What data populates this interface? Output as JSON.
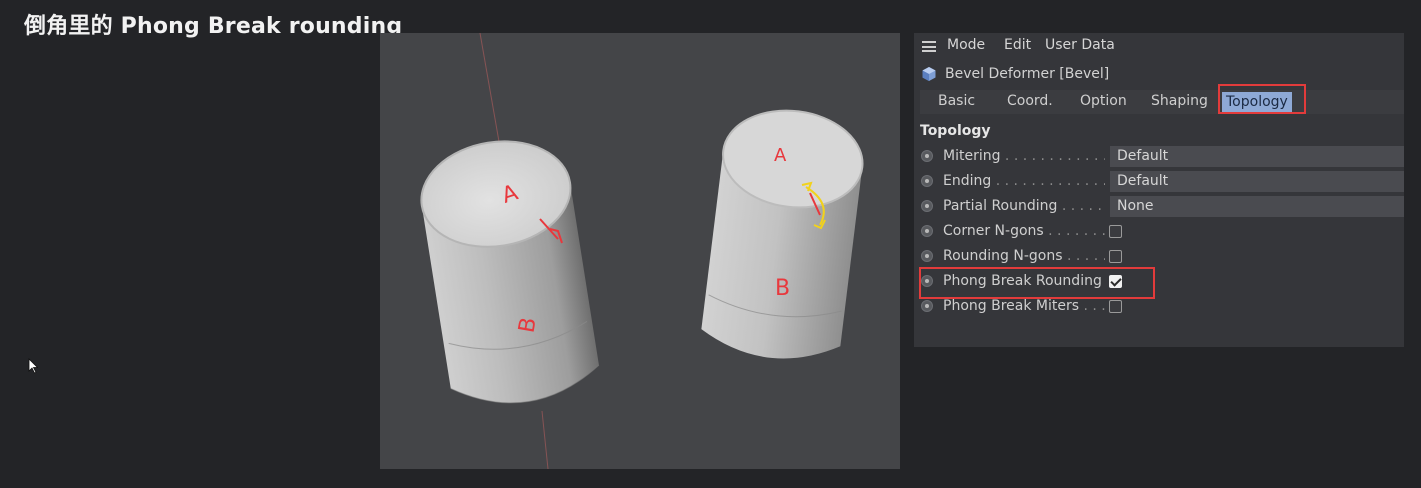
{
  "slide": {
    "title": "倒角里的 Phong Break rounding"
  },
  "viewport": {
    "left_cylinder_labels": [
      "A",
      "B"
    ],
    "right_cylinder_labels": [
      "A",
      "B"
    ],
    "annotation_color": "#e8383d",
    "arrow_color": "#f2d21b"
  },
  "panel": {
    "menu": {
      "mode": "Mode",
      "edit": "Edit",
      "user_data": "User Data"
    },
    "object_name": "Bevel Deformer [Bevel]",
    "tabs": [
      {
        "label": "Basic",
        "active": false
      },
      {
        "label": "Coord.",
        "active": false
      },
      {
        "label": "Option",
        "active": false
      },
      {
        "label": "Shaping",
        "active": false
      },
      {
        "label": "Topology",
        "active": true
      }
    ],
    "section_title": "Topology",
    "properties": [
      {
        "label": "Mitering",
        "dots": " . . . . . . . . . . . . .",
        "type": "dropdown",
        "value": "Default"
      },
      {
        "label": "Ending",
        "dots": " . . . . . . . . . . . . . .",
        "type": "dropdown",
        "value": "Default"
      },
      {
        "label": "Partial Rounding",
        "dots": " . . . . . .",
        "type": "dropdown",
        "value": "None"
      },
      {
        "label": "Corner N-gons",
        "dots": " . . . . . . . .",
        "type": "checkbox",
        "checked": false
      },
      {
        "label": "Rounding N-gons",
        "dots": " . . . . . .",
        "type": "checkbox",
        "checked": false
      },
      {
        "label": "Phong Break Rounding",
        "dots": "",
        "type": "checkbox",
        "checked": true
      },
      {
        "label": "Phong Break Miters",
        "dots": " . . . .",
        "type": "checkbox",
        "checked": false
      }
    ],
    "highlight_color": "#e23b3b",
    "active_tab_color": "#8ea9d6"
  }
}
